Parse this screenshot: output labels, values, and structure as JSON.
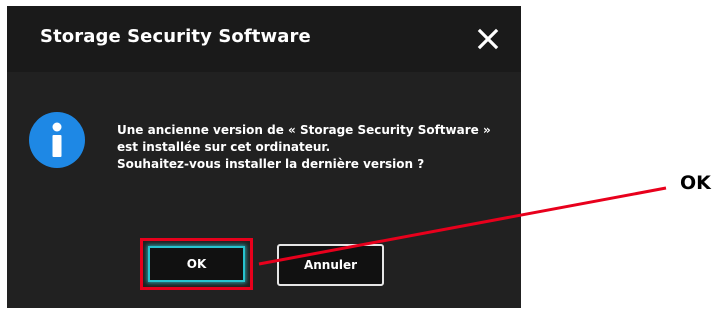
{
  "dialog": {
    "title": "Storage Security Software",
    "close_icon": "close-icon",
    "info_icon": "info-icon",
    "message_lines": [
      "Une ancienne version de « Storage Security Software »",
      "est installée sur cet ordinateur.",
      "Souhaitez-vous installer la dernière version ?"
    ],
    "buttons": {
      "ok_label": "OK",
      "cancel_label": "Annuler"
    }
  },
  "annotation": {
    "label": "OK",
    "highlight_color": "#e8001c"
  },
  "colors": {
    "dialog_background": "#212121",
    "titlebar_background": "#1a1a1a",
    "info_icon_blue": "#1e88e5",
    "focus_ring": "#27c3cf"
  }
}
